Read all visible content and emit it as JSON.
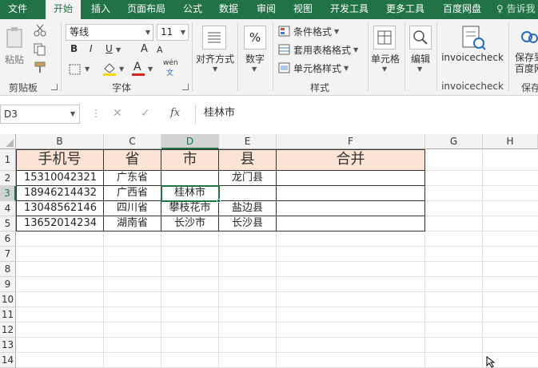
{
  "tabs": [
    "文件",
    "开始",
    "插入",
    "页面布局",
    "公式",
    "数据",
    "审阅",
    "视图",
    "开发工具",
    "更多工具",
    "百度网盘"
  ],
  "tell_me": "告诉我",
  "clipboard": {
    "paste": "粘贴",
    "group": "剪贴板"
  },
  "font": {
    "name": "等线",
    "size": "11",
    "bold": "B",
    "italic": "I",
    "underline": "U",
    "grow": "A",
    "shrink": "A",
    "color_a": "A",
    "wen": "wén",
    "wen_sub": "文",
    "group": "字体"
  },
  "alignment": {
    "label": "对齐方式"
  },
  "number": {
    "symbol": "%",
    "label": "数字"
  },
  "styles": {
    "conditional": "条件格式",
    "table": "套用表格格式",
    "cell_styles": "单元格样式",
    "group": "样式"
  },
  "cells": {
    "label": "单元格"
  },
  "editing": {
    "label": "编辑"
  },
  "invoicecheck": {
    "label": "invoicecheck",
    "group": "invoicecheck"
  },
  "save": {
    "line1": "保存到",
    "line2": "百度网",
    "group": "保存"
  },
  "namebox": "D3",
  "formula_icons": {
    "cancel": "✕",
    "enter": "✓",
    "fx": "fx"
  },
  "formula": "桂林市",
  "columns": [
    "B",
    "C",
    "D",
    "E",
    "F",
    "G",
    "H"
  ],
  "rows": [
    "1",
    "2",
    "3",
    "4",
    "5",
    "6",
    "7",
    "8",
    "9",
    "10",
    "11",
    "12",
    "13",
    "14"
  ],
  "headers": [
    "手机号",
    "省",
    "市",
    "县",
    "合并"
  ],
  "data": [
    [
      "15310042321",
      "广东省",
      "",
      "龙门县",
      ""
    ],
    [
      "18946214432",
      "广西省",
      "桂林市",
      "",
      ""
    ],
    [
      "13048562146",
      "四川省",
      "攀枝花市",
      "盐边县",
      ""
    ],
    [
      "13652014234",
      "湖南省",
      "长沙市",
      "长沙县",
      ""
    ]
  ],
  "colors": {
    "accent": "#217346",
    "header_fill": "#fbe4d5"
  }
}
